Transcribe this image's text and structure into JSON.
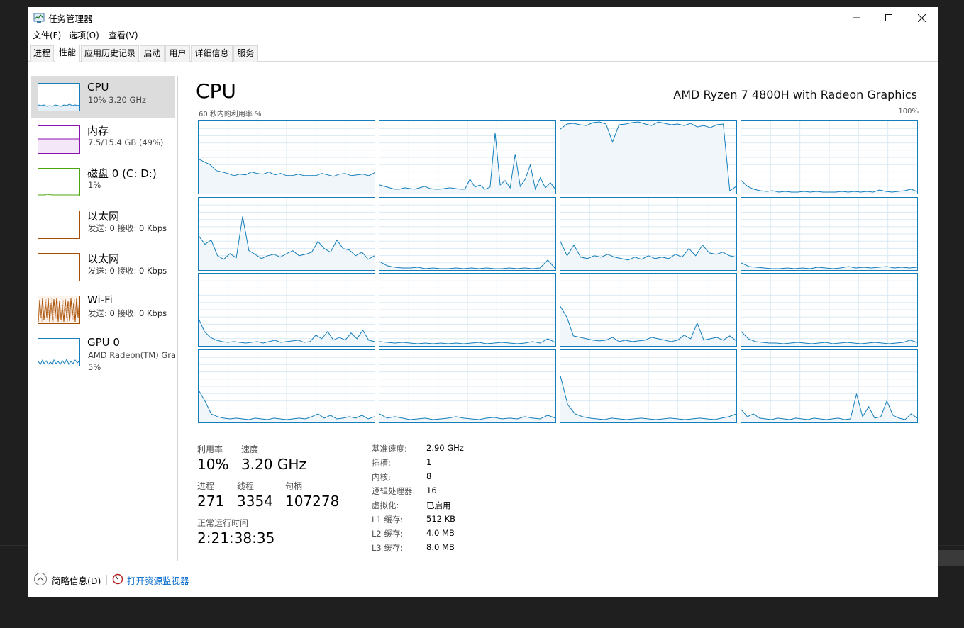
{
  "window": {
    "title": "任务管理器"
  },
  "menu": [
    "文件(F)",
    "选项(O)",
    "查看(V)"
  ],
  "tabs": [
    "进程",
    "性能",
    "应用历史记录",
    "启动",
    "用户",
    "详细信息",
    "服务"
  ],
  "active_tab": "性能",
  "sidebar": {
    "items": [
      {
        "name": "CPU",
        "detail": "10%  3.20 GHz",
        "color": "#117dbb",
        "selected": true
      },
      {
        "name": "内存",
        "detail": "7.5/15.4 GB (49%)",
        "color": "#8b12ae"
      },
      {
        "name": "磁盘 0 (C: D:)",
        "detail": "1%",
        "color": "#4da60c"
      },
      {
        "name": "以太网",
        "sent_label": "发送:",
        "sent": "0",
        "recv_label": "接收:",
        "recv": "0 Kbps",
        "color": "#a74f01"
      },
      {
        "name": "以太网",
        "sent_label": "发送:",
        "sent": "0",
        "recv_label": "接收:",
        "recv": "0 Kbps",
        "color": "#a74f01"
      },
      {
        "name": "Wi-Fi",
        "sent_label": "发送:",
        "sent": "0",
        "recv_label": "接收:",
        "recv": "0 Kbps",
        "color": "#a74f01"
      },
      {
        "name": "GPU 0",
        "detail": "AMD Radeon(TM) Gra",
        "detail2": "5%",
        "color": "#117dbb"
      }
    ]
  },
  "main": {
    "heading": "CPU",
    "model": "AMD Ryzen 7 4800H with Radeon Graphics",
    "util_label": "60 秒内的利用率 %",
    "util_max": "100%"
  },
  "chart_data": {
    "type": "area",
    "ylim": [
      0,
      100
    ],
    "series": [
      {
        "values": [
          48,
          44,
          40,
          32,
          30,
          28,
          25,
          27,
          26,
          30,
          28,
          27,
          30,
          26,
          28,
          25,
          25,
          27,
          25,
          25,
          25,
          28,
          26,
          24,
          27,
          28,
          25,
          26,
          27,
          25,
          29
        ]
      },
      {
        "values": [
          12,
          10,
          8,
          6,
          6,
          8,
          7,
          6,
          8,
          10,
          7,
          6,
          6,
          7,
          8,
          7,
          6,
          6,
          20,
          9,
          12,
          6,
          9,
          85,
          12,
          18,
          8,
          55,
          10,
          20,
          40,
          6,
          22,
          8,
          15,
          6
        ]
      },
      {
        "values": [
          90,
          97,
          98,
          96,
          95,
          99,
          100,
          97,
          72,
          96,
          97,
          99,
          100,
          97,
          95,
          100,
          98,
          96,
          97,
          95,
          98,
          93,
          95,
          92,
          96,
          97,
          4,
          10
        ]
      },
      {
        "values": [
          18,
          10,
          6,
          4,
          3,
          4,
          2,
          3,
          2,
          2,
          3,
          2,
          3,
          2,
          2,
          2,
          3,
          2,
          3,
          2,
          3,
          2,
          5,
          3,
          2,
          3,
          4,
          6,
          3
        ]
      },
      {
        "values": [
          48,
          36,
          42,
          20,
          15,
          23,
          17,
          75,
          27,
          22,
          16,
          20,
          22,
          18,
          23,
          27,
          20,
          22,
          25,
          40,
          30,
          25,
          42,
          30,
          28,
          20,
          25,
          15,
          20
        ]
      },
      {
        "values": [
          12,
          6,
          4,
          3,
          3,
          4,
          2,
          3,
          2,
          2,
          3,
          2,
          3,
          2,
          3,
          2,
          2,
          3,
          2,
          3,
          2,
          3,
          14,
          2
        ]
      },
      {
        "values": [
          40,
          20,
          35,
          18,
          16,
          20,
          18,
          22,
          18,
          16,
          14,
          18,
          15,
          20,
          16,
          18,
          16,
          22,
          18,
          30,
          20,
          35,
          24,
          22,
          25,
          20,
          18
        ]
      },
      {
        "values": [
          10,
          5,
          4,
          3,
          2,
          2,
          3,
          2,
          3,
          2,
          4,
          3,
          2,
          3,
          5,
          3,
          4,
          3,
          4,
          5,
          3,
          4,
          3,
          4
        ]
      },
      {
        "values": [
          38,
          20,
          12,
          8,
          6,
          5,
          6,
          5,
          4,
          5,
          6,
          4,
          6,
          8,
          5,
          6,
          7,
          8,
          5,
          6,
          15,
          10,
          20,
          8,
          12,
          8,
          18,
          10,
          22,
          8,
          6
        ]
      },
      {
        "values": [
          6,
          5,
          4,
          5,
          4,
          3,
          4,
          3,
          4,
          3,
          4,
          3,
          4,
          5,
          3,
          4,
          5,
          4,
          3,
          4,
          6,
          4,
          10,
          5
        ]
      },
      {
        "values": [
          55,
          40,
          14,
          12,
          10,
          8,
          7,
          8,
          12,
          6,
          8,
          6,
          7,
          8,
          12,
          10,
          8,
          6,
          8,
          15,
          10,
          32,
          8,
          10,
          12,
          8,
          14,
          7
        ]
      },
      {
        "values": [
          20,
          10,
          6,
          5,
          4,
          4,
          3,
          4,
          5,
          4,
          3,
          4,
          5,
          3,
          4,
          5,
          4,
          3,
          4,
          5,
          4,
          3,
          4,
          5,
          8,
          5
        ]
      },
      {
        "values": [
          45,
          30,
          12,
          8,
          6,
          5,
          6,
          5,
          4,
          6,
          5,
          4,
          6,
          5,
          4,
          5,
          6,
          5,
          8,
          12,
          6,
          10,
          5,
          6,
          8,
          6,
          10,
          5,
          8
        ]
      },
      {
        "values": [
          12,
          6,
          8,
          6,
          4,
          5,
          6,
          4,
          5,
          6,
          8,
          6,
          5,
          4,
          6,
          7,
          5,
          6,
          5,
          8,
          6,
          5,
          10,
          6
        ]
      },
      {
        "values": [
          65,
          25,
          12,
          8,
          6,
          5,
          4,
          6,
          5,
          4,
          5,
          6,
          5,
          4,
          5,
          6,
          5,
          4,
          5,
          6,
          5,
          4,
          6,
          8,
          12
        ]
      },
      {
        "values": [
          18,
          8,
          12,
          6,
          5,
          4,
          6,
          5,
          4,
          6,
          5,
          4,
          6,
          5,
          4,
          5,
          6,
          4,
          5,
          40,
          8,
          22,
          6,
          8,
          30,
          10,
          6,
          4,
          12,
          6
        ]
      }
    ]
  },
  "stats": {
    "util_label": "利用率",
    "util": "10%",
    "speed_label": "速度",
    "speed": "3.20 GHz",
    "proc_label": "进程",
    "proc": "271",
    "thread_label": "线程",
    "thread": "3354",
    "handle_label": "句柄",
    "handle": "107278",
    "uptime_label": "正常运行时间",
    "uptime": "2:21:38:35"
  },
  "specs": [
    {
      "label": "基准速度:",
      "value": "2.90 GHz"
    },
    {
      "label": "插槽:",
      "value": "1"
    },
    {
      "label": "内核:",
      "value": "8"
    },
    {
      "label": "逻辑处理器:",
      "value": "16"
    },
    {
      "label": "虚拟化:",
      "value": "已启用"
    },
    {
      "label": "L1 缓存:",
      "value": "512 KB"
    },
    {
      "label": "L2 缓存:",
      "value": "4.0 MB"
    },
    {
      "label": "L3 缓存:",
      "value": "8.0 MB"
    }
  ],
  "footer": {
    "fewer_details": "简略信息(D)",
    "open_monitor": "打开资源监视器"
  },
  "colors": {
    "cpu": "#117dbb",
    "grid": "#d9eaf4",
    "fill": "#f1f6fa"
  }
}
